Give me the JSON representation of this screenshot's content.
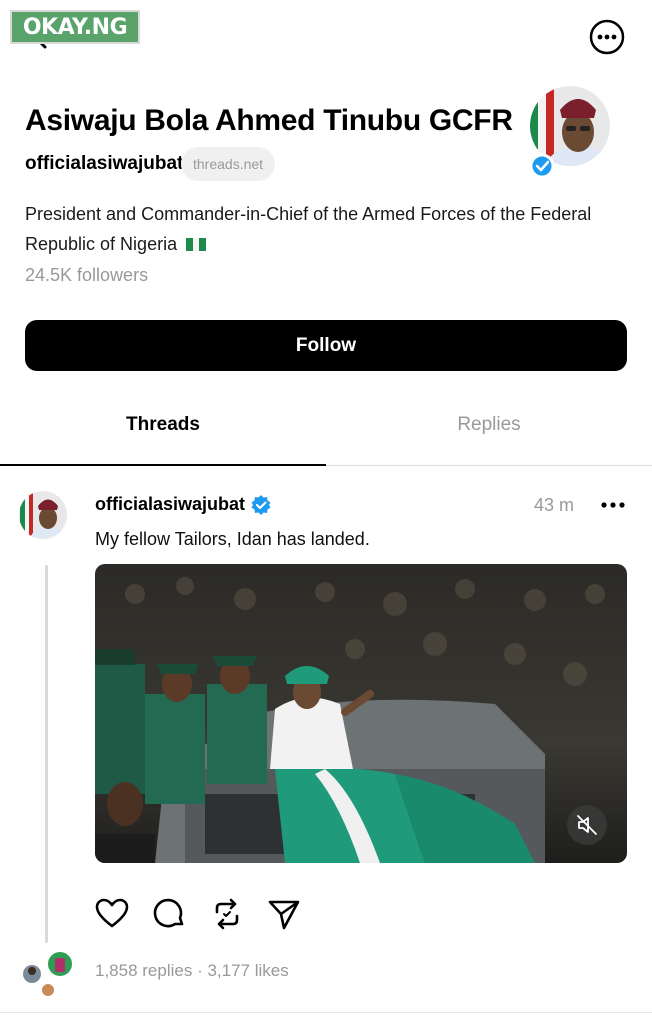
{
  "watermark": "OKAY.NG",
  "profile": {
    "name": "Asiwaju Bola Ahmed Tinubu GCFR",
    "handle": "officialasiwajubat",
    "domain": "threads.net",
    "bio_line1": "President and Commander-in-Chief of the Armed Forces of the Federal",
    "bio_line2": "Republic of Nigeria",
    "followers": "24.5K followers",
    "follow_label": "Follow"
  },
  "tabs": [
    {
      "label": "Threads",
      "active": true
    },
    {
      "label": "Replies",
      "active": false
    }
  ],
  "post": {
    "author": "officialasiwajubat",
    "time": "43 m",
    "text": "My fellow Tailors, Idan has landed.",
    "media_muted": true,
    "stats": "1,858 replies · 3,177 likes"
  },
  "icons": {
    "back": "back-arrow-icon",
    "more": "more-options-icon",
    "verified": "verified-badge-icon",
    "like": "heart-icon",
    "comment": "comment-icon",
    "repost": "repost-icon",
    "share": "share-icon",
    "mute": "muted-speaker-icon"
  },
  "colors": {
    "accent_verified": "#1d9bf0",
    "follow_button": "#000000",
    "muted_text": "#999999",
    "watermark_bg": "#5aa36b"
  }
}
